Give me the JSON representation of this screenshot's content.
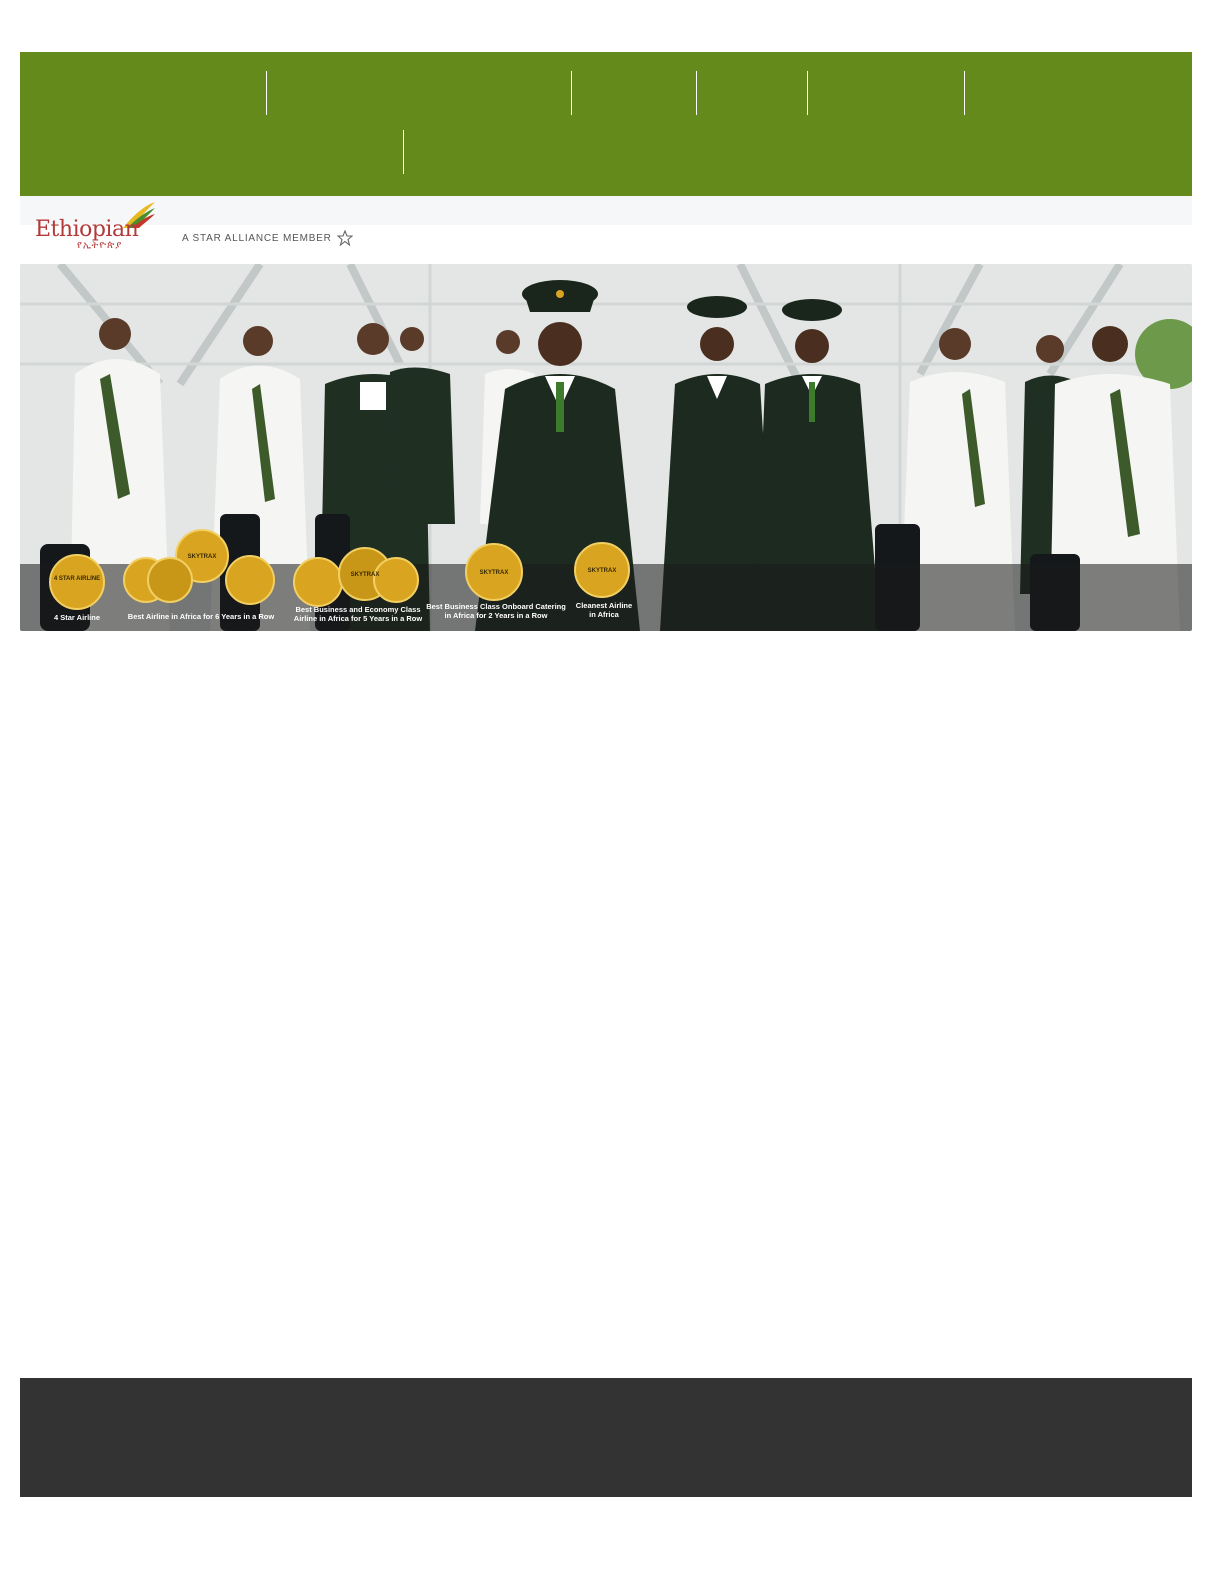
{
  "nav": {
    "row1": [
      "",
      "",
      "",
      "",
      "",
      ""
    ],
    "row2": [
      "",
      ""
    ]
  },
  "brand": {
    "name": "Ethiopian",
    "amharic": "የኢትዮጵያ",
    "alliance": "A STAR ALLIANCE MEMBER",
    "alliance_icon": "star-alliance-icon"
  },
  "hero": {
    "description_icon": "crew-photo",
    "awards": [
      {
        "badge": "4 STAR AIRLINE",
        "label": "4 Star Airline"
      },
      {
        "badge": "SKYTRAX",
        "label": "Best Airline in Africa for 6 Years in a Row"
      },
      {
        "badge": "SKYTRAX",
        "label_line1": "Best Business and Economy Class",
        "label_line2": "Airline in Africa for 5 Years in a Row"
      },
      {
        "badge": "SKYTRAX",
        "label_line1": "Best Business Class Onboard Catering",
        "label_line2": "in Africa for 2 Years in a Row"
      },
      {
        "badge": "SKYTRAX",
        "label_line1": "Cleanest Airline",
        "label_line2": "in Africa"
      }
    ]
  },
  "colors": {
    "nav_bg": "#648a1c",
    "brand_red": "#b23a3a",
    "footer_bg": "#333333",
    "award_gold": "#d9a520"
  }
}
